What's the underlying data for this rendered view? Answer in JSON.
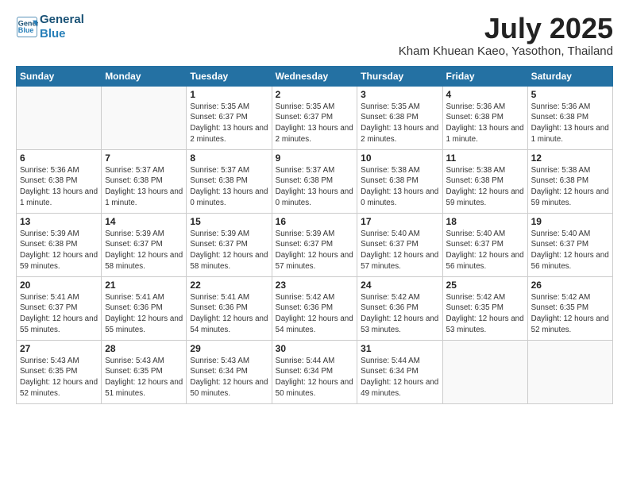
{
  "header": {
    "logo_line1": "General",
    "logo_line2": "Blue",
    "month": "July 2025",
    "location": "Kham Khuean Kaeo, Yasothon, Thailand"
  },
  "weekdays": [
    "Sunday",
    "Monday",
    "Tuesday",
    "Wednesday",
    "Thursday",
    "Friday",
    "Saturday"
  ],
  "weeks": [
    [
      {
        "day": "",
        "info": ""
      },
      {
        "day": "",
        "info": ""
      },
      {
        "day": "1",
        "info": "Sunrise: 5:35 AM\nSunset: 6:37 PM\nDaylight: 13 hours and 2 minutes."
      },
      {
        "day": "2",
        "info": "Sunrise: 5:35 AM\nSunset: 6:37 PM\nDaylight: 13 hours and 2 minutes."
      },
      {
        "day": "3",
        "info": "Sunrise: 5:35 AM\nSunset: 6:38 PM\nDaylight: 13 hours and 2 minutes."
      },
      {
        "day": "4",
        "info": "Sunrise: 5:36 AM\nSunset: 6:38 PM\nDaylight: 13 hours and 1 minute."
      },
      {
        "day": "5",
        "info": "Sunrise: 5:36 AM\nSunset: 6:38 PM\nDaylight: 13 hours and 1 minute."
      }
    ],
    [
      {
        "day": "6",
        "info": "Sunrise: 5:36 AM\nSunset: 6:38 PM\nDaylight: 13 hours and 1 minute."
      },
      {
        "day": "7",
        "info": "Sunrise: 5:37 AM\nSunset: 6:38 PM\nDaylight: 13 hours and 1 minute."
      },
      {
        "day": "8",
        "info": "Sunrise: 5:37 AM\nSunset: 6:38 PM\nDaylight: 13 hours and 0 minutes."
      },
      {
        "day": "9",
        "info": "Sunrise: 5:37 AM\nSunset: 6:38 PM\nDaylight: 13 hours and 0 minutes."
      },
      {
        "day": "10",
        "info": "Sunrise: 5:38 AM\nSunset: 6:38 PM\nDaylight: 13 hours and 0 minutes."
      },
      {
        "day": "11",
        "info": "Sunrise: 5:38 AM\nSunset: 6:38 PM\nDaylight: 12 hours and 59 minutes."
      },
      {
        "day": "12",
        "info": "Sunrise: 5:38 AM\nSunset: 6:38 PM\nDaylight: 12 hours and 59 minutes."
      }
    ],
    [
      {
        "day": "13",
        "info": "Sunrise: 5:39 AM\nSunset: 6:38 PM\nDaylight: 12 hours and 59 minutes."
      },
      {
        "day": "14",
        "info": "Sunrise: 5:39 AM\nSunset: 6:37 PM\nDaylight: 12 hours and 58 minutes."
      },
      {
        "day": "15",
        "info": "Sunrise: 5:39 AM\nSunset: 6:37 PM\nDaylight: 12 hours and 58 minutes."
      },
      {
        "day": "16",
        "info": "Sunrise: 5:39 AM\nSunset: 6:37 PM\nDaylight: 12 hours and 57 minutes."
      },
      {
        "day": "17",
        "info": "Sunrise: 5:40 AM\nSunset: 6:37 PM\nDaylight: 12 hours and 57 minutes."
      },
      {
        "day": "18",
        "info": "Sunrise: 5:40 AM\nSunset: 6:37 PM\nDaylight: 12 hours and 56 minutes."
      },
      {
        "day": "19",
        "info": "Sunrise: 5:40 AM\nSunset: 6:37 PM\nDaylight: 12 hours and 56 minutes."
      }
    ],
    [
      {
        "day": "20",
        "info": "Sunrise: 5:41 AM\nSunset: 6:37 PM\nDaylight: 12 hours and 55 minutes."
      },
      {
        "day": "21",
        "info": "Sunrise: 5:41 AM\nSunset: 6:36 PM\nDaylight: 12 hours and 55 minutes."
      },
      {
        "day": "22",
        "info": "Sunrise: 5:41 AM\nSunset: 6:36 PM\nDaylight: 12 hours and 54 minutes."
      },
      {
        "day": "23",
        "info": "Sunrise: 5:42 AM\nSunset: 6:36 PM\nDaylight: 12 hours and 54 minutes."
      },
      {
        "day": "24",
        "info": "Sunrise: 5:42 AM\nSunset: 6:36 PM\nDaylight: 12 hours and 53 minutes."
      },
      {
        "day": "25",
        "info": "Sunrise: 5:42 AM\nSunset: 6:35 PM\nDaylight: 12 hours and 53 minutes."
      },
      {
        "day": "26",
        "info": "Sunrise: 5:42 AM\nSunset: 6:35 PM\nDaylight: 12 hours and 52 minutes."
      }
    ],
    [
      {
        "day": "27",
        "info": "Sunrise: 5:43 AM\nSunset: 6:35 PM\nDaylight: 12 hours and 52 minutes."
      },
      {
        "day": "28",
        "info": "Sunrise: 5:43 AM\nSunset: 6:35 PM\nDaylight: 12 hours and 51 minutes."
      },
      {
        "day": "29",
        "info": "Sunrise: 5:43 AM\nSunset: 6:34 PM\nDaylight: 12 hours and 50 minutes."
      },
      {
        "day": "30",
        "info": "Sunrise: 5:44 AM\nSunset: 6:34 PM\nDaylight: 12 hours and 50 minutes."
      },
      {
        "day": "31",
        "info": "Sunrise: 5:44 AM\nSunset: 6:34 PM\nDaylight: 12 hours and 49 minutes."
      },
      {
        "day": "",
        "info": ""
      },
      {
        "day": "",
        "info": ""
      }
    ]
  ]
}
